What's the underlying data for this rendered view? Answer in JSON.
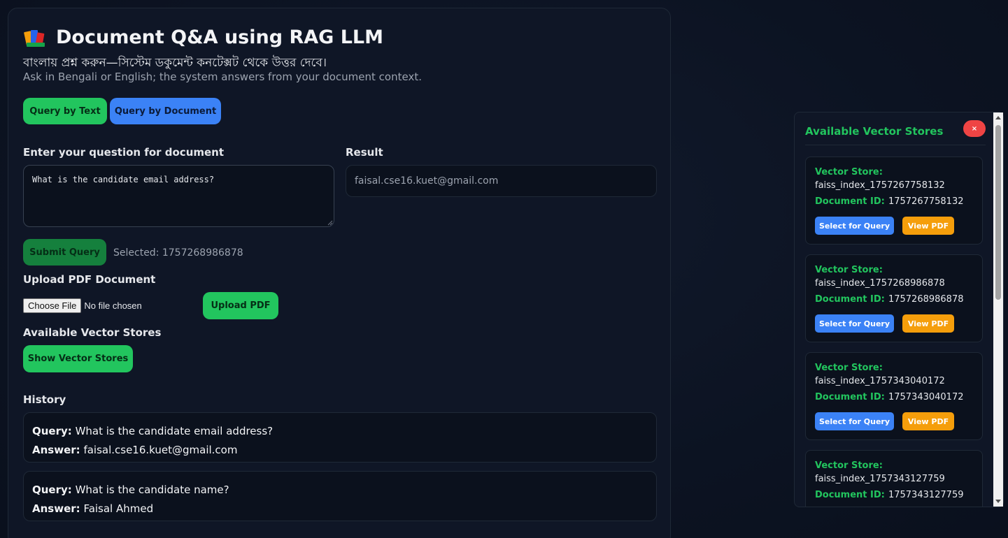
{
  "header": {
    "title": "Document Q&A using RAG LLM",
    "subtitle_bn": "বাংলায় প্রশ্ন করুন—সিস্টেম ডকুমেন্ট কনটেক্সট থেকে উত্তর দেবে।",
    "subtitle_en": "Ask in Bengali or English; the system answers from your document context."
  },
  "modes": {
    "text_label": "Query by Text",
    "document_label": "Query by Document"
  },
  "question": {
    "label": "Enter your question for document",
    "value": "What is the candidate email address?"
  },
  "result": {
    "label": "Result",
    "value": "faisal.cse16.kuet@gmail.com"
  },
  "submit": {
    "label": "Submit Query",
    "selected_text": "Selected: 1757268986878"
  },
  "upload": {
    "label": "Upload PDF Document",
    "choose_file": "Choose File",
    "no_file": "No file chosen",
    "button": "Upload PDF"
  },
  "stores_section": {
    "label": "Available Vector Stores",
    "button": "Show Vector Stores"
  },
  "history": {
    "label": "History",
    "query_key": "Query:",
    "answer_key": "Answer:",
    "items": [
      {
        "query": "What is the candidate email address?",
        "answer": "faisal.cse16.kuet@gmail.com"
      },
      {
        "query": "What is the candidate name?",
        "answer": "Faisal Ahmed"
      }
    ]
  },
  "panel": {
    "title": "Available Vector Stores",
    "close": "×",
    "store_key": "Vector Store:",
    "doc_key": "Document ID:",
    "select_label": "Select for Query",
    "view_label": "View PDF",
    "stores": [
      {
        "name": "faiss_index_1757267758132",
        "doc_id": "1757267758132"
      },
      {
        "name": "faiss_index_1757268986878",
        "doc_id": "1757268986878"
      },
      {
        "name": "faiss_index_1757343040172",
        "doc_id": "1757343040172"
      },
      {
        "name": "faiss_index_1757343127759",
        "doc_id": "1757343127759"
      }
    ]
  },
  "colors": {
    "green": "#22c55e",
    "blue": "#3b82f6",
    "orange": "#f59e0b",
    "red": "#ef4444"
  }
}
